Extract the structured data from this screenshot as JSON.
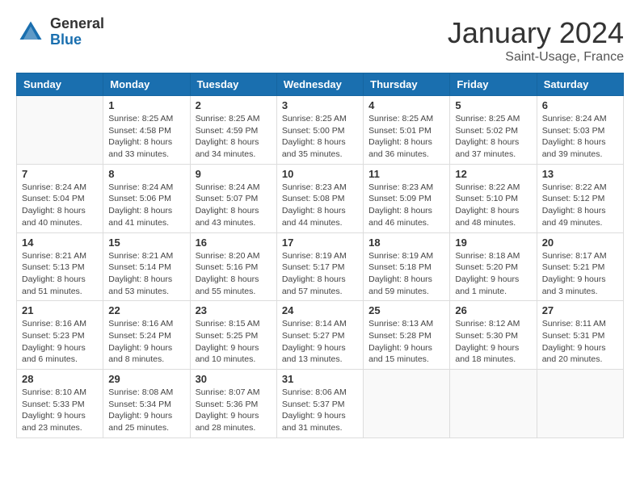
{
  "header": {
    "logo_general": "General",
    "logo_blue": "Blue",
    "title": "January 2024",
    "location": "Saint-Usage, France"
  },
  "days_of_week": [
    "Sunday",
    "Monday",
    "Tuesday",
    "Wednesday",
    "Thursday",
    "Friday",
    "Saturday"
  ],
  "weeks": [
    [
      {
        "day": "",
        "info": ""
      },
      {
        "day": "1",
        "info": "Sunrise: 8:25 AM\nSunset: 4:58 PM\nDaylight: 8 hours\nand 33 minutes."
      },
      {
        "day": "2",
        "info": "Sunrise: 8:25 AM\nSunset: 4:59 PM\nDaylight: 8 hours\nand 34 minutes."
      },
      {
        "day": "3",
        "info": "Sunrise: 8:25 AM\nSunset: 5:00 PM\nDaylight: 8 hours\nand 35 minutes."
      },
      {
        "day": "4",
        "info": "Sunrise: 8:25 AM\nSunset: 5:01 PM\nDaylight: 8 hours\nand 36 minutes."
      },
      {
        "day": "5",
        "info": "Sunrise: 8:25 AM\nSunset: 5:02 PM\nDaylight: 8 hours\nand 37 minutes."
      },
      {
        "day": "6",
        "info": "Sunrise: 8:24 AM\nSunset: 5:03 PM\nDaylight: 8 hours\nand 39 minutes."
      }
    ],
    [
      {
        "day": "7",
        "info": "Sunrise: 8:24 AM\nSunset: 5:04 PM\nDaylight: 8 hours\nand 40 minutes."
      },
      {
        "day": "8",
        "info": "Sunrise: 8:24 AM\nSunset: 5:06 PM\nDaylight: 8 hours\nand 41 minutes."
      },
      {
        "day": "9",
        "info": "Sunrise: 8:24 AM\nSunset: 5:07 PM\nDaylight: 8 hours\nand 43 minutes."
      },
      {
        "day": "10",
        "info": "Sunrise: 8:23 AM\nSunset: 5:08 PM\nDaylight: 8 hours\nand 44 minutes."
      },
      {
        "day": "11",
        "info": "Sunrise: 8:23 AM\nSunset: 5:09 PM\nDaylight: 8 hours\nand 46 minutes."
      },
      {
        "day": "12",
        "info": "Sunrise: 8:22 AM\nSunset: 5:10 PM\nDaylight: 8 hours\nand 48 minutes."
      },
      {
        "day": "13",
        "info": "Sunrise: 8:22 AM\nSunset: 5:12 PM\nDaylight: 8 hours\nand 49 minutes."
      }
    ],
    [
      {
        "day": "14",
        "info": "Sunrise: 8:21 AM\nSunset: 5:13 PM\nDaylight: 8 hours\nand 51 minutes."
      },
      {
        "day": "15",
        "info": "Sunrise: 8:21 AM\nSunset: 5:14 PM\nDaylight: 8 hours\nand 53 minutes."
      },
      {
        "day": "16",
        "info": "Sunrise: 8:20 AM\nSunset: 5:16 PM\nDaylight: 8 hours\nand 55 minutes."
      },
      {
        "day": "17",
        "info": "Sunrise: 8:19 AM\nSunset: 5:17 PM\nDaylight: 8 hours\nand 57 minutes."
      },
      {
        "day": "18",
        "info": "Sunrise: 8:19 AM\nSunset: 5:18 PM\nDaylight: 8 hours\nand 59 minutes."
      },
      {
        "day": "19",
        "info": "Sunrise: 8:18 AM\nSunset: 5:20 PM\nDaylight: 9 hours\nand 1 minute."
      },
      {
        "day": "20",
        "info": "Sunrise: 8:17 AM\nSunset: 5:21 PM\nDaylight: 9 hours\nand 3 minutes."
      }
    ],
    [
      {
        "day": "21",
        "info": "Sunrise: 8:16 AM\nSunset: 5:23 PM\nDaylight: 9 hours\nand 6 minutes."
      },
      {
        "day": "22",
        "info": "Sunrise: 8:16 AM\nSunset: 5:24 PM\nDaylight: 9 hours\nand 8 minutes."
      },
      {
        "day": "23",
        "info": "Sunrise: 8:15 AM\nSunset: 5:25 PM\nDaylight: 9 hours\nand 10 minutes."
      },
      {
        "day": "24",
        "info": "Sunrise: 8:14 AM\nSunset: 5:27 PM\nDaylight: 9 hours\nand 13 minutes."
      },
      {
        "day": "25",
        "info": "Sunrise: 8:13 AM\nSunset: 5:28 PM\nDaylight: 9 hours\nand 15 minutes."
      },
      {
        "day": "26",
        "info": "Sunrise: 8:12 AM\nSunset: 5:30 PM\nDaylight: 9 hours\nand 18 minutes."
      },
      {
        "day": "27",
        "info": "Sunrise: 8:11 AM\nSunset: 5:31 PM\nDaylight: 9 hours\nand 20 minutes."
      }
    ],
    [
      {
        "day": "28",
        "info": "Sunrise: 8:10 AM\nSunset: 5:33 PM\nDaylight: 9 hours\nand 23 minutes."
      },
      {
        "day": "29",
        "info": "Sunrise: 8:08 AM\nSunset: 5:34 PM\nDaylight: 9 hours\nand 25 minutes."
      },
      {
        "day": "30",
        "info": "Sunrise: 8:07 AM\nSunset: 5:36 PM\nDaylight: 9 hours\nand 28 minutes."
      },
      {
        "day": "31",
        "info": "Sunrise: 8:06 AM\nSunset: 5:37 PM\nDaylight: 9 hours\nand 31 minutes."
      },
      {
        "day": "",
        "info": ""
      },
      {
        "day": "",
        "info": ""
      },
      {
        "day": "",
        "info": ""
      }
    ]
  ]
}
